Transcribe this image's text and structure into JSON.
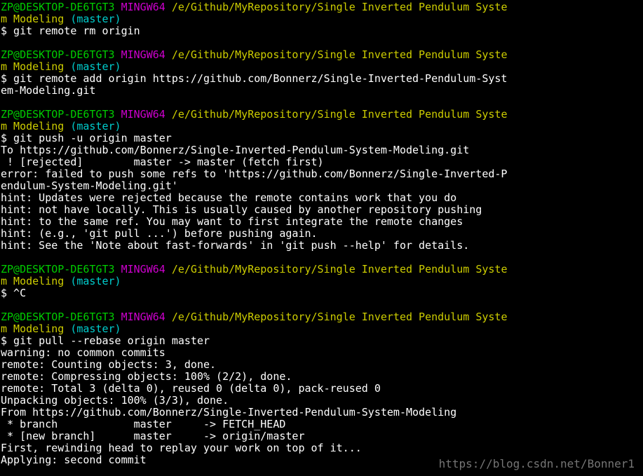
{
  "colors": {
    "background": "#000000",
    "text": "#ffffff",
    "user_host": "#00cd00",
    "msystem": "#cd00cd",
    "path": "#cdcd00",
    "branch": "#00cdcd",
    "watermark": "#8a8a8a"
  },
  "lines": [
    {
      "segments": [
        {
          "text": "ZP@DESKTOP-DE6TGT3",
          "color": "green"
        },
        {
          "text": " ",
          "color": "white"
        },
        {
          "text": "MINGW64",
          "color": "magenta"
        },
        {
          "text": " ",
          "color": "white"
        },
        {
          "text": "/e/Github/MyRepository/Single Inverted Pendulum Syste",
          "color": "yellow"
        }
      ]
    },
    {
      "segments": [
        {
          "text": "m Modeling",
          "color": "yellow"
        },
        {
          "text": " ",
          "color": "white"
        },
        {
          "text": "(master)",
          "color": "cyan"
        }
      ]
    },
    {
      "segments": [
        {
          "text": "$ git remote rm origin",
          "color": "white"
        }
      ]
    },
    {
      "segments": [
        {
          "text": "",
          "color": "white"
        }
      ]
    },
    {
      "segments": [
        {
          "text": "ZP@DESKTOP-DE6TGT3",
          "color": "green"
        },
        {
          "text": " ",
          "color": "white"
        },
        {
          "text": "MINGW64",
          "color": "magenta"
        },
        {
          "text": " ",
          "color": "white"
        },
        {
          "text": "/e/Github/MyRepository/Single Inverted Pendulum Syste",
          "color": "yellow"
        }
      ]
    },
    {
      "segments": [
        {
          "text": "m Modeling",
          "color": "yellow"
        },
        {
          "text": " ",
          "color": "white"
        },
        {
          "text": "(master)",
          "color": "cyan"
        }
      ]
    },
    {
      "segments": [
        {
          "text": "$ git remote add origin https://github.com/Bonnerz/Single-Inverted-Pendulum-Syst",
          "color": "white"
        }
      ]
    },
    {
      "segments": [
        {
          "text": "em-Modeling.git",
          "color": "white"
        }
      ]
    },
    {
      "segments": [
        {
          "text": "",
          "color": "white"
        }
      ]
    },
    {
      "segments": [
        {
          "text": "ZP@DESKTOP-DE6TGT3",
          "color": "green"
        },
        {
          "text": " ",
          "color": "white"
        },
        {
          "text": "MINGW64",
          "color": "magenta"
        },
        {
          "text": " ",
          "color": "white"
        },
        {
          "text": "/e/Github/MyRepository/Single Inverted Pendulum Syste",
          "color": "yellow"
        }
      ]
    },
    {
      "segments": [
        {
          "text": "m Modeling",
          "color": "yellow"
        },
        {
          "text": " ",
          "color": "white"
        },
        {
          "text": "(master)",
          "color": "cyan"
        }
      ]
    },
    {
      "segments": [
        {
          "text": "$ git push -u origin master",
          "color": "white"
        }
      ]
    },
    {
      "segments": [
        {
          "text": "To https://github.com/Bonnerz/Single-Inverted-Pendulum-System-Modeling.git",
          "color": "white"
        }
      ]
    },
    {
      "segments": [
        {
          "text": " ! [rejected]        master -> master (fetch first)",
          "color": "white"
        }
      ]
    },
    {
      "segments": [
        {
          "text": "error: failed to push some refs to 'https://github.com/Bonnerz/Single-Inverted-P",
          "color": "white"
        }
      ]
    },
    {
      "segments": [
        {
          "text": "endulum-System-Modeling.git'",
          "color": "white"
        }
      ]
    },
    {
      "segments": [
        {
          "text": "hint: Updates were rejected because the remote contains work that you do",
          "color": "white"
        }
      ]
    },
    {
      "segments": [
        {
          "text": "hint: not have locally. This is usually caused by another repository pushing",
          "color": "white"
        }
      ]
    },
    {
      "segments": [
        {
          "text": "hint: to the same ref. You may want to first integrate the remote changes",
          "color": "white"
        }
      ]
    },
    {
      "segments": [
        {
          "text": "hint: (e.g., 'git pull ...') before pushing again.",
          "color": "white"
        }
      ]
    },
    {
      "segments": [
        {
          "text": "hint: See the 'Note about fast-forwards' in 'git push --help' for details.",
          "color": "white"
        }
      ]
    },
    {
      "segments": [
        {
          "text": "",
          "color": "white"
        }
      ]
    },
    {
      "segments": [
        {
          "text": "ZP@DESKTOP-DE6TGT3",
          "color": "green"
        },
        {
          "text": " ",
          "color": "white"
        },
        {
          "text": "MINGW64",
          "color": "magenta"
        },
        {
          "text": " ",
          "color": "white"
        },
        {
          "text": "/e/Github/MyRepository/Single Inverted Pendulum Syste",
          "color": "yellow"
        }
      ]
    },
    {
      "segments": [
        {
          "text": "m Modeling",
          "color": "yellow"
        },
        {
          "text": " ",
          "color": "white"
        },
        {
          "text": "(master)",
          "color": "cyan"
        }
      ]
    },
    {
      "segments": [
        {
          "text": "$ ^C",
          "color": "white"
        }
      ]
    },
    {
      "segments": [
        {
          "text": "",
          "color": "white"
        }
      ]
    },
    {
      "segments": [
        {
          "text": "ZP@DESKTOP-DE6TGT3",
          "color": "green"
        },
        {
          "text": " ",
          "color": "white"
        },
        {
          "text": "MINGW64",
          "color": "magenta"
        },
        {
          "text": " ",
          "color": "white"
        },
        {
          "text": "/e/Github/MyRepository/Single Inverted Pendulum Syste",
          "color": "yellow"
        }
      ]
    },
    {
      "segments": [
        {
          "text": "m Modeling",
          "color": "yellow"
        },
        {
          "text": " ",
          "color": "white"
        },
        {
          "text": "(master)",
          "color": "cyan"
        }
      ]
    },
    {
      "segments": [
        {
          "text": "$ git pull --rebase origin master",
          "color": "white"
        }
      ]
    },
    {
      "segments": [
        {
          "text": "warning: no common commits",
          "color": "white"
        }
      ]
    },
    {
      "segments": [
        {
          "text": "remote: Counting objects: 3, done.",
          "color": "white"
        }
      ]
    },
    {
      "segments": [
        {
          "text": "remote: Compressing objects: 100% (2/2), done.",
          "color": "white"
        }
      ]
    },
    {
      "segments": [
        {
          "text": "remote: Total 3 (delta 0), reused 0 (delta 0), pack-reused 0",
          "color": "white"
        }
      ]
    },
    {
      "segments": [
        {
          "text": "Unpacking objects: 100% (3/3), done.",
          "color": "white"
        }
      ]
    },
    {
      "segments": [
        {
          "text": "From https://github.com/Bonnerz/Single-Inverted-Pendulum-System-Modeling",
          "color": "white"
        }
      ]
    },
    {
      "segments": [
        {
          "text": " * branch            master     -> FETCH_HEAD",
          "color": "white"
        }
      ]
    },
    {
      "segments": [
        {
          "text": " * [new branch]      master     -> origin/master",
          "color": "white"
        }
      ]
    },
    {
      "segments": [
        {
          "text": "First, rewinding head to replay your work on top of it...",
          "color": "white"
        }
      ]
    },
    {
      "segments": [
        {
          "text": "Applying: second commit",
          "color": "white"
        }
      ]
    }
  ],
  "watermark": "https://blog.csdn.net/Bonner1"
}
